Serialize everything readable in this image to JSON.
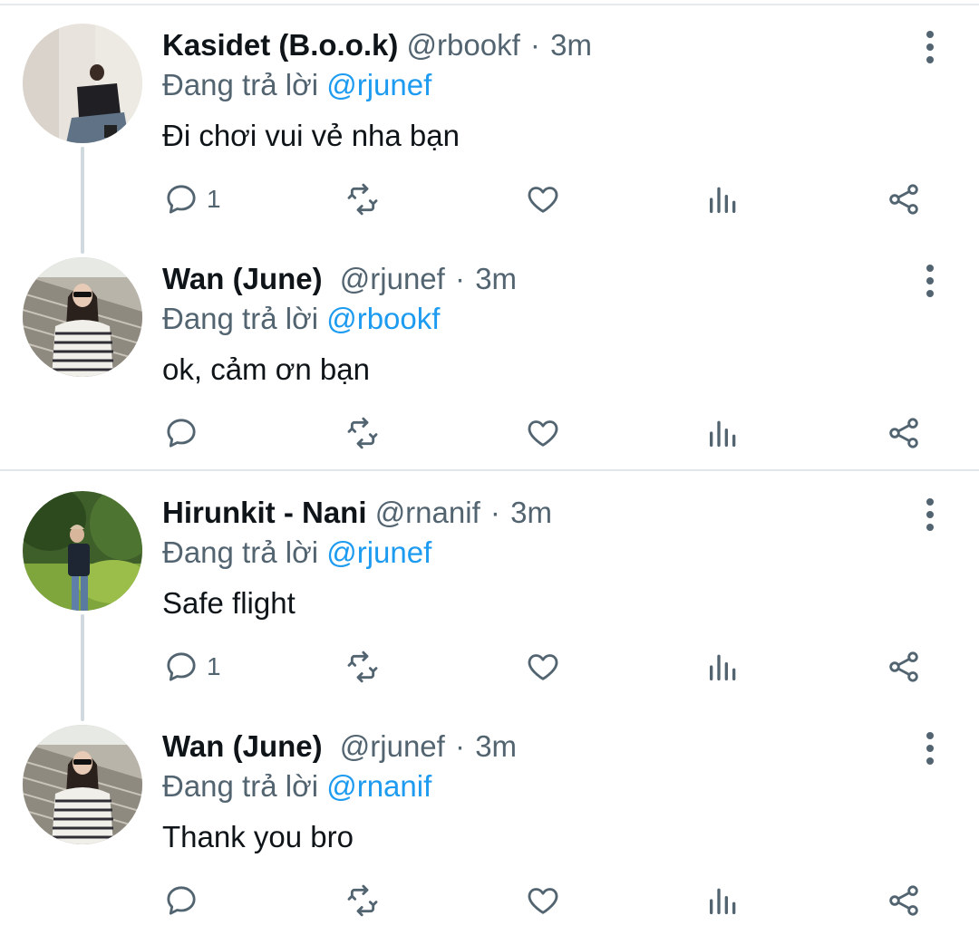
{
  "colors": {
    "text": "#0f1419",
    "secondary": "#536471",
    "accent": "#1d9bf0",
    "divider": "#e1e6ea",
    "thread_line": "#cfd9de"
  },
  "icons": {
    "reply": "reply-icon",
    "retweet": "retweet-icon",
    "like": "heart-icon",
    "views": "analytics-icon",
    "share": "share-icon",
    "more": "more-vertical-icon"
  },
  "tweets": [
    {
      "name": "Kasidet (B.o.o.k)",
      "handle": "@rbookf",
      "separator": "·",
      "time": "3m",
      "replying_prefix": "Đang trả lời",
      "replying_to": "@rjunef",
      "text": "Đi chơi vui vẻ nha bạn",
      "reply_count": "1"
    },
    {
      "name": "Wan (June)",
      "handle": "@rjunef",
      "separator": "·",
      "time": "3m",
      "replying_prefix": "Đang trả lời",
      "replying_to": "@rbookf",
      "text": "ok, cảm ơn bạn",
      "reply_count": ""
    },
    {
      "name": "Hirunkit - Nani",
      "handle": "@rnanif",
      "separator": "·",
      "time": "3m",
      "replying_prefix": "Đang trả lời",
      "replying_to": "@rjunef",
      "text": "Safe flight",
      "reply_count": "1"
    },
    {
      "name": "Wan (June)",
      "handle": "@rjunef",
      "separator": "·",
      "time": "3m",
      "replying_prefix": "Đang trả lời",
      "replying_to": "@rnanif",
      "text": "Thank you bro",
      "reply_count": ""
    }
  ]
}
